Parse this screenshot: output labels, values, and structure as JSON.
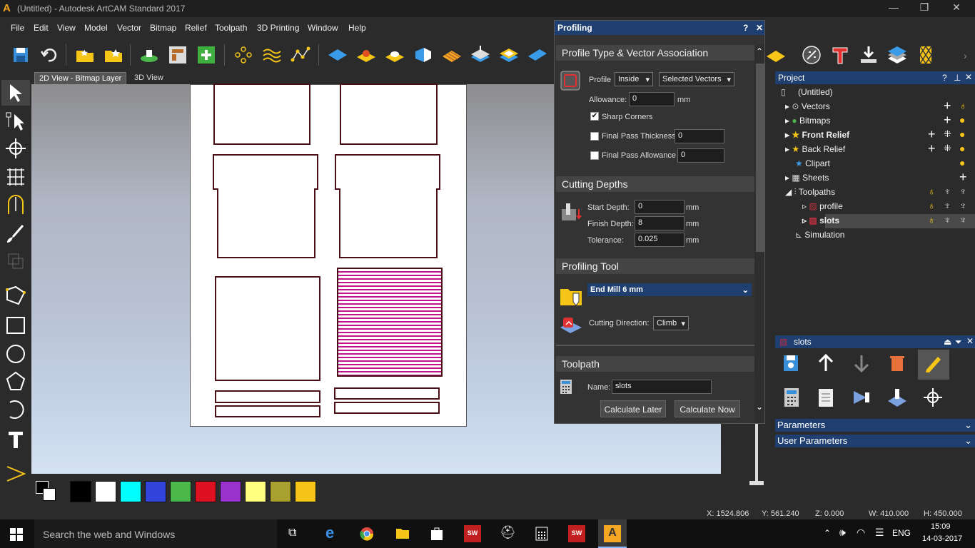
{
  "window": {
    "title": "(Untitled) - Autodesk ArtCAM Standard 2017",
    "app_logo": "A",
    "minimize": "—",
    "restore": "❐",
    "close": "✕"
  },
  "menu": [
    "File",
    "Edit",
    "View",
    "Model",
    "Vector",
    "Bitmap",
    "Relief",
    "Toolpath",
    "3D Printing",
    "Window",
    "Help"
  ],
  "tabs": {
    "view2d": "2D View - Bitmap Layer",
    "view3d": "3D View"
  },
  "profiling": {
    "title": "Profiling",
    "help": "?",
    "close": "✕",
    "sec_profile": "Profile Type & Vector Association",
    "profile_label": "Profile",
    "profile_value": "Inside",
    "vectors_value": "Selected Vectors",
    "allowance_label": "Allowance:",
    "allowance_value": "0",
    "mm": "mm",
    "sharp_corners": "Sharp Corners",
    "final_pass_thickness": "Final Pass Thickness",
    "final_pass_thickness_value": "0",
    "final_pass_allowance": "Final Pass Allowance",
    "final_pass_allowance_value": "0",
    "sec_depths": "Cutting Depths",
    "start_depth_label": "Start Depth:",
    "start_depth": "0",
    "finish_depth_label": "Finish Depth:",
    "finish_depth": "8",
    "tolerance_label": "Tolerance:",
    "tolerance": "0.025",
    "sec_tool": "Profiling Tool",
    "tool": "End Mill 6 mm",
    "cutting_direction_label": "Cutting Direction:",
    "cutting_direction": "Climb",
    "sec_toolpath": "Toolpath",
    "name_label": "Name:",
    "name_value": "slots",
    "calc_later": "Calculate Later",
    "calc_now": "Calculate Now"
  },
  "project": {
    "title": "Project",
    "items": [
      {
        "label": "(Untitled)"
      },
      {
        "label": "Vectors"
      },
      {
        "label": "Bitmaps"
      },
      {
        "label": "Front Relief"
      },
      {
        "label": "Back Relief"
      },
      {
        "label": "Clipart"
      },
      {
        "label": "Sheets"
      },
      {
        "label": "Toolpaths"
      },
      {
        "label": "profile"
      },
      {
        "label": "slots"
      },
      {
        "label": "Simulation"
      }
    ]
  },
  "slots_panel": {
    "title": "slots"
  },
  "accordion": {
    "parameters": "Parameters",
    "user_parameters": "User Parameters"
  },
  "status": {
    "x": "X: 1524.806",
    "y": "Y: 561.240",
    "z": "Z: 0.000",
    "w": "W: 410.000",
    "h": "H: 450.000"
  },
  "taskbar": {
    "search": "Search the web and Windows",
    "lang": "ENG",
    "time": "15:09",
    "date": "14-03-2017"
  },
  "swatch_colors": [
    "#000000",
    "#ffffff",
    "#00ffff",
    "#3344dd",
    "#4cb84c",
    "#dd1122",
    "#9933cc",
    "#ffff80",
    "#a8a030",
    "#f5c518"
  ],
  "accent": "#1f3f70"
}
